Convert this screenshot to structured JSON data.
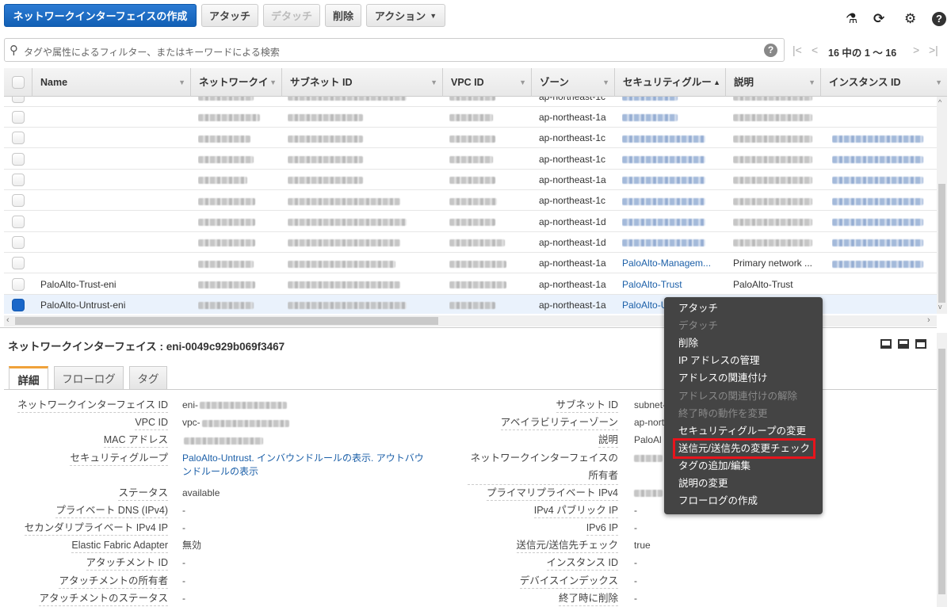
{
  "toolbar": {
    "create_label": "ネットワークインターフェイスの作成",
    "attach_label": "アタッチ",
    "detach_label": "デタッチ",
    "delete_label": "削除",
    "actions_label": "アクション",
    "icons": [
      "flask-icon",
      "refresh-icon",
      "gear-icon",
      "help-icon"
    ]
  },
  "search": {
    "placeholder": "タグや属性によるフィルター、またはキーワードによる検索"
  },
  "pagination": {
    "text": "16 中の 1 ～ 16"
  },
  "table": {
    "columns": [
      "Name",
      "ネットワークイ",
      "サブネット ID",
      "VPC ID",
      "ゾーン",
      "セキュリティグルー",
      "説明",
      "インスタンス ID"
    ],
    "sorted_column": "セキュリティグルー",
    "rows": [
      {
        "name": "",
        "zone": "ap-northeast-1c",
        "security_group": null,
        "description": null,
        "instance": "",
        "redacted": [
          "sg",
          "desc"
        ]
      },
      {
        "name": "",
        "zone": "ap-northeast-1a",
        "security_group": null,
        "description": null,
        "instance": "",
        "redacted": [
          "sg",
          "desc"
        ]
      },
      {
        "name": "",
        "zone": "ap-northeast-1c",
        "security_group": null,
        "description": null,
        "instance": null,
        "redacted": [
          "sg",
          "desc",
          "instance"
        ]
      },
      {
        "name": "",
        "zone": "ap-northeast-1c",
        "security_group": null,
        "description": null,
        "instance": null,
        "redacted": [
          "sg",
          "desc",
          "instance"
        ]
      },
      {
        "name": "",
        "zone": "ap-northeast-1a",
        "security_group": null,
        "description": null,
        "instance": null,
        "redacted": [
          "sg",
          "desc",
          "instance"
        ]
      },
      {
        "name": "",
        "zone": "ap-northeast-1c",
        "security_group": null,
        "description": null,
        "instance": null,
        "redacted": [
          "sg",
          "desc",
          "instance"
        ]
      },
      {
        "name": "",
        "zone": "ap-northeast-1d",
        "security_group": null,
        "description": null,
        "instance": null,
        "redacted": [
          "sg",
          "desc",
          "instance"
        ]
      },
      {
        "name": "",
        "zone": "ap-northeast-1d",
        "security_group": null,
        "description": null,
        "instance": null,
        "redacted": [
          "sg",
          "desc",
          "instance"
        ]
      },
      {
        "name": "",
        "zone": "ap-northeast-1a",
        "security_group": "PaloAlto-Managem...",
        "description": "Primary network ...",
        "instance": null,
        "redacted": [
          "instance"
        ]
      },
      {
        "name": "PaloAlto-Trust-eni",
        "zone": "ap-northeast-1a",
        "security_group": "PaloAlto-Trust",
        "description": "PaloAlto-Trust",
        "instance": "",
        "redacted": []
      },
      {
        "name": "PaloAlto-Untrust-eni",
        "zone": "ap-northeast-1a",
        "security_group": "PaloAlto-U",
        "description": "",
        "instance": "",
        "redacted": [],
        "selected": true
      }
    ]
  },
  "detail": {
    "title": "ネットワークインターフェイス : eni-0049c929b069f3467",
    "tabs": [
      "詳細",
      "フローログ",
      "タグ"
    ],
    "active_tab": "詳細",
    "left": [
      {
        "label": "ネットワークインターフェイス ID",
        "value": "eni-",
        "redacted": true
      },
      {
        "label": "VPC ID",
        "value": "vpc-",
        "redacted": true
      },
      {
        "label": "MAC アドレス",
        "value": "",
        "redacted": true
      },
      {
        "label": "セキュリティグループ",
        "value": "PaloAlto-Untrust. インバウンドルールの表示. アウトバウンドルールの表示",
        "link": true
      },
      {
        "label": "ステータス",
        "value": "available"
      },
      {
        "label": "プライベート DNS (IPv4)",
        "value": "-"
      },
      {
        "label": "セカンダリプライベート IPv4 IP",
        "value": "-"
      },
      {
        "label": "Elastic Fabric Adapter",
        "value": "無効"
      },
      {
        "label": "アタッチメント ID",
        "value": "-"
      },
      {
        "label": "アタッチメントの所有者",
        "value": "-"
      },
      {
        "label": "アタッチメントのステータス",
        "value": "-"
      }
    ],
    "right": [
      {
        "label": "サブネット ID",
        "value": "subnet-"
      },
      {
        "label": "アベイラビリティーゾーン",
        "value": "ap-nort"
      },
      {
        "label": "説明",
        "value": "PaloAl"
      },
      {
        "label": "ネットワークインターフェイスの所有者",
        "value": "",
        "redacted": true
      },
      {
        "label": "プライマリプライベート IPv4",
        "value": "",
        "redacted": true
      },
      {
        "label": "IPv4 パブリック IP",
        "value": "-"
      },
      {
        "label": "IPv6 IP",
        "value": "-"
      },
      {
        "label": "送信元/送信先チェック",
        "value": "true"
      },
      {
        "label": "インスタンス ID",
        "value": "-"
      },
      {
        "label": "デバイスインデックス",
        "value": "-"
      },
      {
        "label": "終了時に削除",
        "value": "-"
      }
    ]
  },
  "context_menu": {
    "items": [
      {
        "label": "アタッチ",
        "enabled": true
      },
      {
        "label": "デタッチ",
        "enabled": false
      },
      {
        "label": "削除",
        "enabled": true
      },
      {
        "label": "IP アドレスの管理",
        "enabled": true
      },
      {
        "label": "アドレスの関連付け",
        "enabled": true
      },
      {
        "label": "アドレスの関連付けの解除",
        "enabled": false
      },
      {
        "label": "終了時の動作を変更",
        "enabled": false
      },
      {
        "label": "セキュリティグループの変更",
        "enabled": true
      },
      {
        "label": "送信元/送信先の変更チェック",
        "enabled": true,
        "highlighted": true
      },
      {
        "label": "タグの追加/編集",
        "enabled": true
      },
      {
        "label": "説明の変更",
        "enabled": true
      },
      {
        "label": "フローログの作成",
        "enabled": true
      }
    ],
    "highlight_color": "#e8141c"
  },
  "colors": {
    "primary": "#1a67c9",
    "link": "#1b5fa8",
    "menu_bg": "#444444",
    "tab_accent": "#f0a23a"
  }
}
